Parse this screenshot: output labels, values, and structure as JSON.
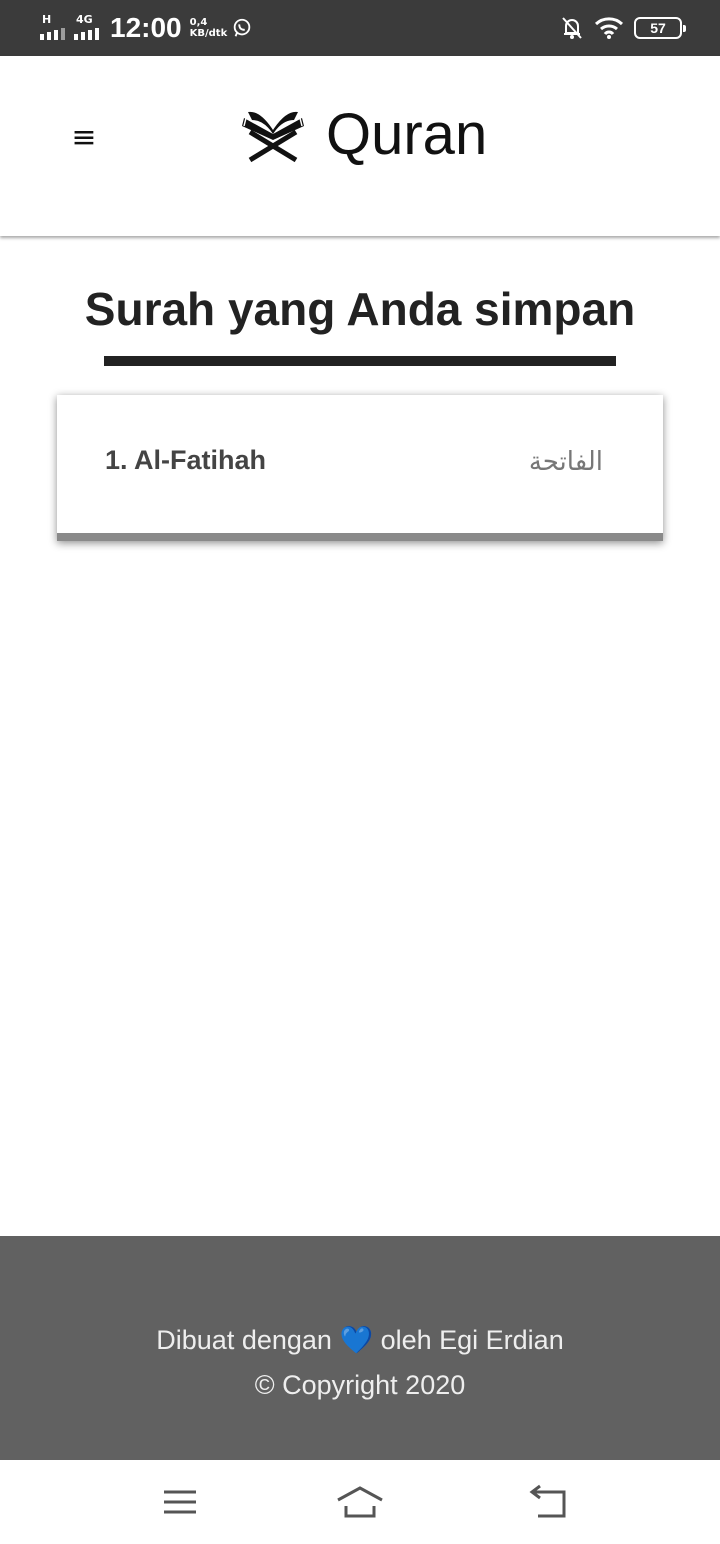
{
  "status_bar": {
    "network_1": "H",
    "network_2": "4G",
    "time": "12:00",
    "speed_value": "0,4",
    "speed_unit": "KB/dtk",
    "battery": "57",
    "icons": [
      "signal-icon",
      "whatsapp-icon",
      "bell-off-icon",
      "wifi-icon",
      "battery-icon"
    ]
  },
  "header": {
    "menu_icon": "≡",
    "title": "Quran"
  },
  "main": {
    "section_title": "Surah yang Anda simpan",
    "saved_surahs": [
      {
        "name": "1. Al-Fatihah",
        "arabic": "الفاتحة"
      }
    ]
  },
  "footer": {
    "line1_before": "Dibuat dengan",
    "heart": "💙",
    "line1_after": "oleh Egi Erdian",
    "copyright": "© Copyright 2020"
  },
  "nav_bar": {
    "icons": [
      "recent-apps-icon",
      "home-icon",
      "back-icon"
    ]
  },
  "colors": {
    "status_bar_bg": "#3b3b3b",
    "footer_bg": "#616161",
    "underline": "#222222"
  }
}
